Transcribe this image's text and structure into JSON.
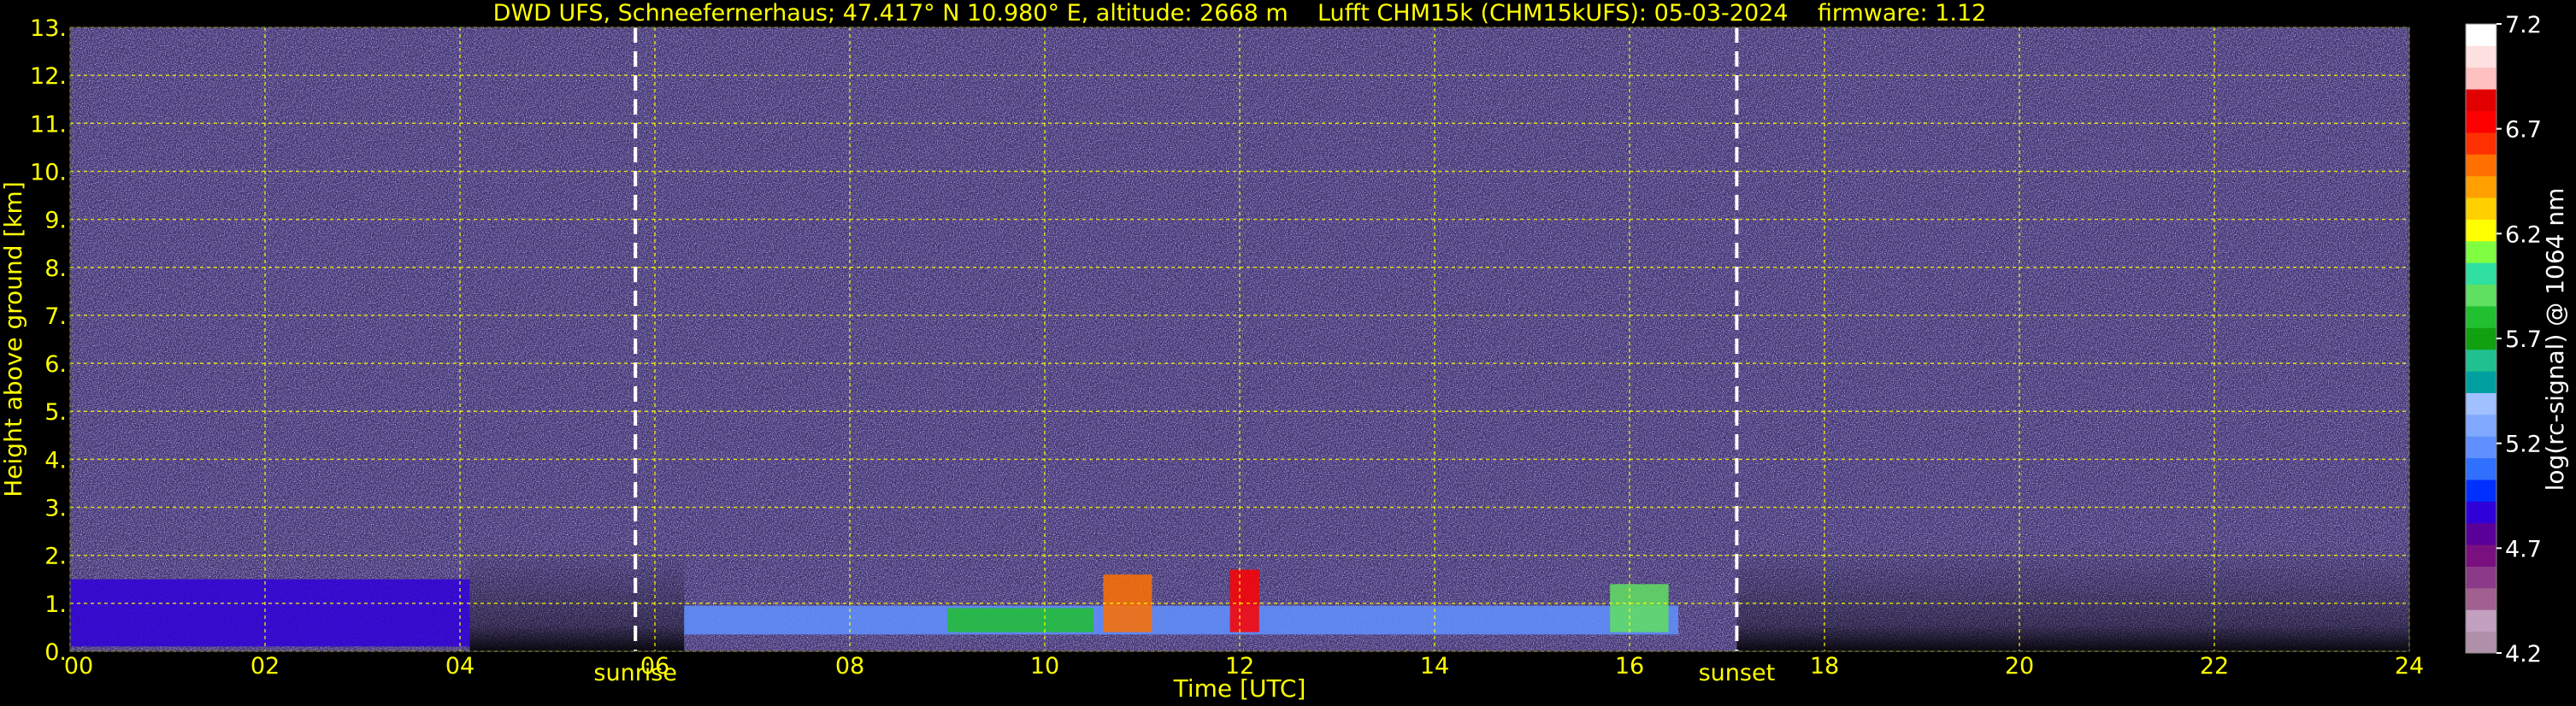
{
  "chart_data": {
    "type": "heatmap",
    "title": "DWD UFS, Schneefernerhaus; 47.417° N 10.980° E, altitude: 2668 m    Lufft CHM15k (CHM15kUFS): 05-03-2024    firmware: 1.12",
    "xlabel": "Time [UTC]",
    "ylabel": "Height above ground [km]",
    "xlim": [
      0,
      24
    ],
    "ylim": [
      0,
      13
    ],
    "x_ticks": [
      "00",
      "02",
      "04",
      "06",
      "08",
      "10",
      "12",
      "14",
      "16",
      "18",
      "20",
      "22",
      "24"
    ],
    "y_ticks": [
      "0.",
      "1.",
      "2.",
      "3.",
      "4.",
      "5.",
      "6.",
      "7.",
      "8.",
      "9.",
      "10.",
      "11.",
      "12.",
      "13."
    ],
    "grid": true,
    "events": [
      {
        "label": "sunrise",
        "time": 5.8
      },
      {
        "label": "sunset",
        "time": 17.1
      }
    ],
    "colorbar": {
      "label": "log(rc-signal) @ 1064 nm",
      "range": [
        4.2,
        7.2
      ],
      "ticks": [
        "7.2",
        "6.7",
        "6.2",
        "5.7",
        "5.2",
        "4.7",
        "4.2"
      ],
      "colors": [
        "#b090a8",
        "#c4a0c0",
        "#a06090",
        "#8a3a88",
        "#7a1080",
        "#5a0098",
        "#3000d8",
        "#0030ff",
        "#3070ff",
        "#6090ff",
        "#80a8ff",
        "#a0c0ff",
        "#00a0a0",
        "#20c090",
        "#10a010",
        "#20c030",
        "#60e060",
        "#30e0a0",
        "#80ff40",
        "#ffff00",
        "#ffd000",
        "#ffa000",
        "#ff7000",
        "#ff3000",
        "#ff0000",
        "#e00000",
        "#ffc0c0",
        "#ffe0e0",
        "#ffffff"
      ]
    },
    "layers": [
      {
        "start": 0.0,
        "end": 4.1,
        "base": 0.1,
        "top": 1.5,
        "value": 4.8
      },
      {
        "start": 6.3,
        "end": 16.5,
        "base": 0.35,
        "top": 0.95,
        "value": 5.2
      },
      {
        "start": 9.0,
        "end": 10.5,
        "base": 0.4,
        "top": 0.9,
        "value": 5.8
      },
      {
        "start": 10.6,
        "end": 11.1,
        "base": 0.4,
        "top": 1.6,
        "value": 6.6
      },
      {
        "start": 11.9,
        "end": 12.2,
        "base": 0.4,
        "top": 1.7,
        "value": 6.8
      },
      {
        "start": 15.8,
        "end": 16.4,
        "base": 0.4,
        "top": 1.4,
        "value": 5.9
      }
    ]
  }
}
